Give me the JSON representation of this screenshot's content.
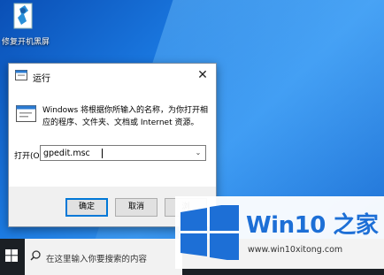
{
  "desktop": {
    "icon_label": "修复开机黑屏"
  },
  "run_dialog": {
    "title": "运行",
    "close_glyph": "✕",
    "description": "Windows 将根据你所输入的名称，为你打开相应的程序、文件夹、文档或 Internet 资源。",
    "open_label": "打开(O):",
    "open_value": "gpedit.msc",
    "dropdown_glyph": "⌄",
    "ok_label": "确定",
    "cancel_label": "取消",
    "browse_label": "浏",
    "accent": "#0078d7"
  },
  "taskbar": {
    "search_placeholder": "在这里输入你要搜索的内容",
    "search_icon": "search-icon",
    "start_icon": "windows-start-icon"
  },
  "watermark": {
    "title_a": "Win10",
    "title_b": "之家",
    "url": "www.win10xitong.com",
    "brand_color": "#1d6fd6"
  }
}
